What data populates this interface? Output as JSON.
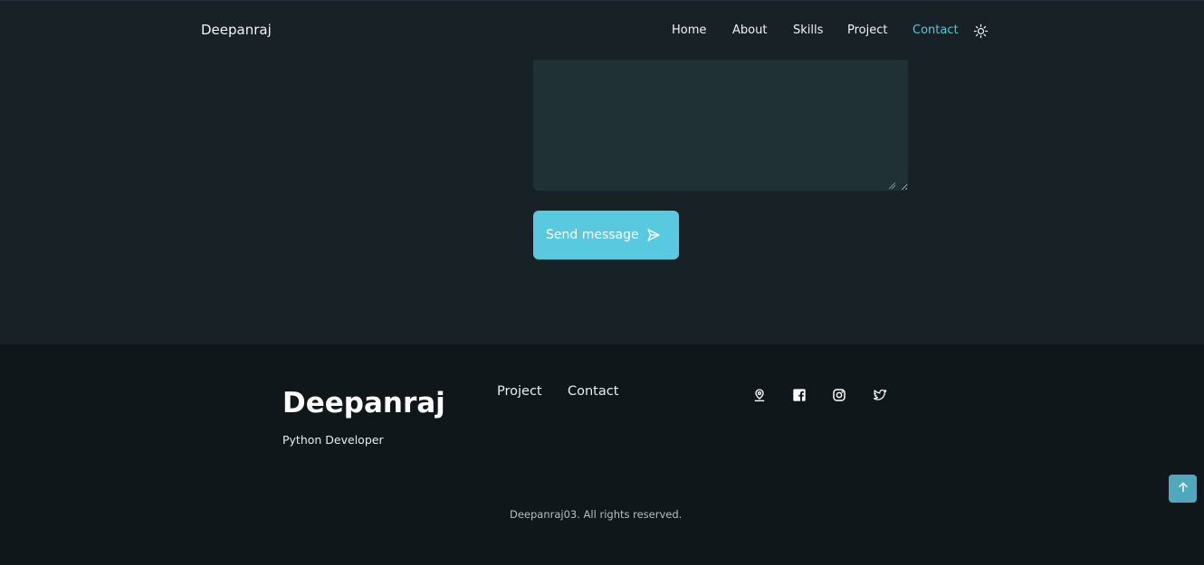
{
  "header": {
    "logo": "Deepanraj",
    "nav": [
      {
        "label": "Home",
        "active": false
      },
      {
        "label": "About",
        "active": false
      },
      {
        "label": "Skills",
        "active": false
      },
      {
        "label": "Project",
        "active": false
      },
      {
        "label": "Contact",
        "active": true
      }
    ],
    "theme_icon": "sun-icon"
  },
  "contact_form": {
    "message_value": "",
    "send_button_label": "Send message",
    "send_icon": "send-icon"
  },
  "footer": {
    "title": "Deepanraj",
    "subtitle": "Python Developer",
    "links": [
      "Project",
      "Contact"
    ],
    "social_icons": [
      "location-pin-icon",
      "facebook-icon",
      "instagram-icon",
      "twitter-icon"
    ],
    "copyright": "Deepanraj03. All rights reserved."
  },
  "scroll_up_icon": "arrow-up-icon",
  "colors": {
    "accent": "#59c9df",
    "page_background": "#182126",
    "footer_background": "#10171a",
    "textarea_background": "#1f3135",
    "scroll_button": "#4fa9bc"
  }
}
